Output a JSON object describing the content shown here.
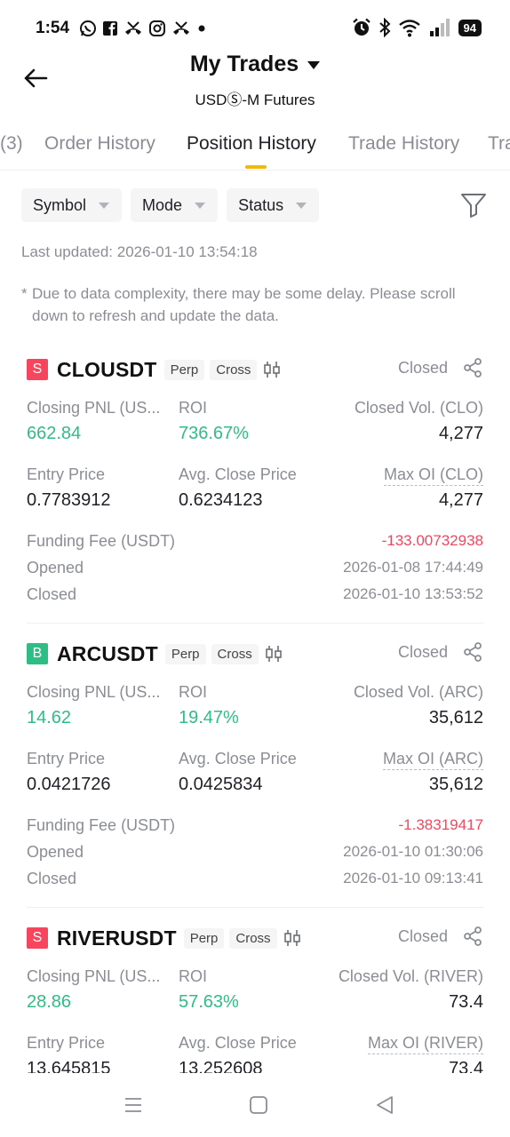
{
  "status_bar": {
    "time": "1:54",
    "battery": "94",
    "left_icons": [
      "whatsapp-icon",
      "facebook-icon",
      "missed-call-icon",
      "instagram-icon",
      "missed-call-icon",
      "dot-icon"
    ],
    "right_icons": [
      "alarm-icon",
      "bluetooth-icon",
      "wifi-icon",
      "signal-icon"
    ]
  },
  "header": {
    "title": "My Trades",
    "subtitle": "USDⓈ-M Futures"
  },
  "tabs": [
    {
      "label": "(3)"
    },
    {
      "label": "Order History"
    },
    {
      "label": "Position History",
      "active": true
    },
    {
      "label": "Trade History"
    },
    {
      "label": "Tra"
    }
  ],
  "filters": {
    "symbol": "Symbol",
    "mode": "Mode",
    "status": "Status"
  },
  "last_updated": "Last updated: 2026-01-10 13:54:18",
  "notice": {
    "star": "*",
    "text": "Due to data complexity, there may be some delay. Please scroll down to refresh and update the data."
  },
  "positions": [
    {
      "side": "S",
      "side_color": "#f6465d",
      "symbol": "CLOUSDT",
      "type_tag": "Perp",
      "margin_tag": "Cross",
      "status": "Closed",
      "closing_pnl_label": "Closing PNL (US...",
      "closing_pnl": "662.84",
      "roi_label": "ROI",
      "roi": "736.67%",
      "closed_vol_label": "Closed Vol. (CLO)",
      "closed_vol": "4,277",
      "entry_price_label": "Entry Price",
      "entry_price": "0.7783912",
      "avg_close_label": "Avg. Close Price",
      "avg_close": "0.6234123",
      "max_oi_label": "Max OI (CLO)",
      "max_oi": "4,277",
      "funding_fee_label": "Funding Fee (USDT)",
      "funding_fee": "-133.00732938",
      "opened_label": "Opened",
      "opened": "2026-01-08 17:44:49",
      "closed_label": "Closed",
      "closed": "2026-01-10 13:53:52"
    },
    {
      "side": "B",
      "side_color": "#2ebd85",
      "symbol": "ARCUSDT",
      "type_tag": "Perp",
      "margin_tag": "Cross",
      "status": "Closed",
      "closing_pnl_label": "Closing PNL (US...",
      "closing_pnl": "14.62",
      "roi_label": "ROI",
      "roi": "19.47%",
      "closed_vol_label": "Closed Vol. (ARC)",
      "closed_vol": "35,612",
      "entry_price_label": "Entry Price",
      "entry_price": "0.0421726",
      "avg_close_label": "Avg. Close Price",
      "avg_close": "0.0425834",
      "max_oi_label": "Max OI (ARC)",
      "max_oi": "35,612",
      "funding_fee_label": "Funding Fee (USDT)",
      "funding_fee": "-1.38319417",
      "opened_label": "Opened",
      "opened": "2026-01-10 01:30:06",
      "closed_label": "Closed",
      "closed": "2026-01-10 09:13:41"
    },
    {
      "side": "S",
      "side_color": "#f6465d",
      "symbol": "RIVERUSDT",
      "type_tag": "Perp",
      "margin_tag": "Cross",
      "status": "Closed",
      "closing_pnl_label": "Closing PNL (US...",
      "closing_pnl": "28.86",
      "roi_label": "ROI",
      "roi": "57.63%",
      "closed_vol_label": "Closed Vol. (RIVER)",
      "closed_vol": "73.4",
      "entry_price_label": "Entry Price",
      "entry_price": "13.645815",
      "avg_close_label": "Avg. Close Price",
      "avg_close": "13.252608",
      "max_oi_label": "Max OI (RIVER)",
      "max_oi": "73.4"
    }
  ],
  "nav_bar": {
    "icons": [
      "recent-apps-icon",
      "home-icon",
      "back-nav-icon"
    ]
  }
}
